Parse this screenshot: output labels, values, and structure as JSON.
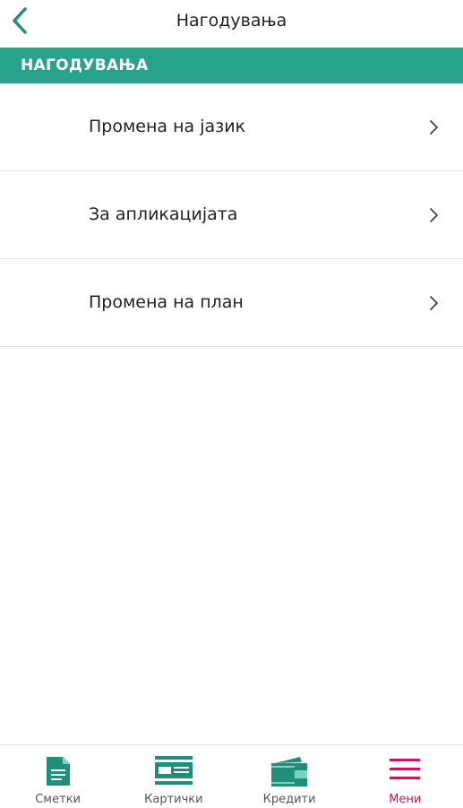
{
  "header": {
    "title": "Нагодувања"
  },
  "section": {
    "title": "НАГОДУВАЊА"
  },
  "menu": {
    "items": [
      {
        "label": "Промена на јазик"
      },
      {
        "label": "За апликацијата"
      },
      {
        "label": "Промена на план"
      }
    ]
  },
  "tabbar": {
    "tabs": [
      {
        "label": "Сметки",
        "icon": "document-icon"
      },
      {
        "label": "Картички",
        "icon": "card-icon"
      },
      {
        "label": "Кредити",
        "icon": "wallet-icon"
      },
      {
        "label": "Мени",
        "icon": "hamburger-menu-icon",
        "active": true
      }
    ]
  },
  "colors": {
    "accent": "#27a38c",
    "active_tab": "#c2185b"
  }
}
